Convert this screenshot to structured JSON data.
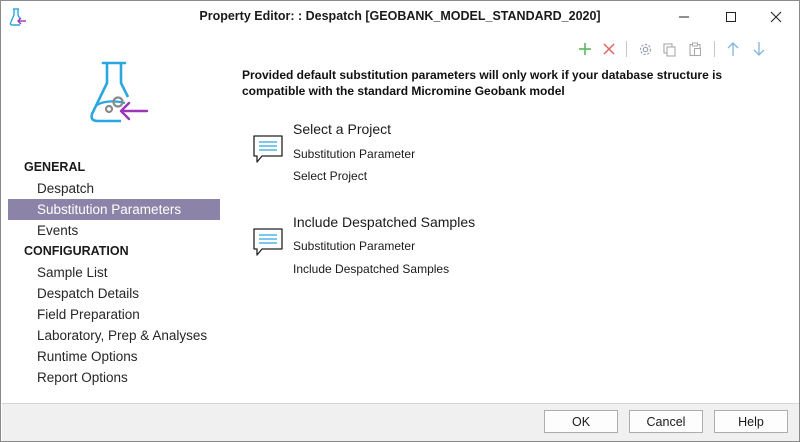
{
  "window": {
    "title": "Property Editor: : Despatch [GEOBANK_MODEL_STANDARD_2020]",
    "app_icon": "flask-arrow-icon"
  },
  "toolbar": {
    "items": [
      "add-icon",
      "delete-icon",
      "settings-icon",
      "copy-icon",
      "paste-icon",
      "arrow-up-icon",
      "arrow-down-icon"
    ]
  },
  "colors": {
    "accent_blue": "#2aa7e0",
    "accent_purple": "#9b36b7",
    "selected_bg": "#8b84a8",
    "add_green": "#5cb85c",
    "delete_red": "#e06666"
  },
  "sidebar": {
    "groups": [
      {
        "label": "GENERAL",
        "items": [
          "Despatch",
          "Substitution Parameters",
          "Events"
        ]
      },
      {
        "label": "CONFIGURATION",
        "items": [
          "Sample List",
          "Despatch Details",
          "Field Preparation",
          "Laboratory, Prep & Analyses",
          "Runtime Options",
          "Report Options"
        ]
      }
    ],
    "selected": "Substitution Parameters"
  },
  "main": {
    "notice": "Provided default substitution parameters will only work if your database structure is compatible with the standard Micromine Geobank model",
    "params": [
      {
        "title": "Select a Project",
        "type_label": "Substitution Parameter",
        "value": "Select Project"
      },
      {
        "title": "Include Despatched Samples",
        "type_label": "Substitution Parameter",
        "value": "Include Despatched Samples"
      }
    ]
  },
  "footer": {
    "ok": "OK",
    "cancel": "Cancel",
    "help": "Help"
  }
}
